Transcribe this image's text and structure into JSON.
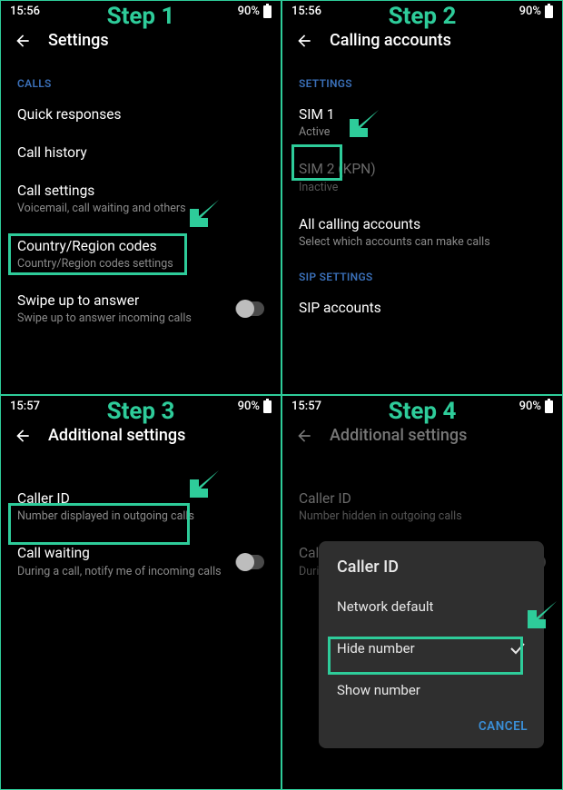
{
  "steps": [
    "Step 1",
    "Step 2",
    "Step 3",
    "Step 4"
  ],
  "status": {
    "time1": "15:56",
    "time2": "15:57",
    "battery": "90%"
  },
  "step1": {
    "title": "Settings",
    "calls_header": "CALLS",
    "quick_responses": "Quick responses",
    "call_history": "Call history",
    "call_settings": "Call settings",
    "call_settings_sub": "Voicemail, call waiting and others",
    "country_codes": "Country/Region codes",
    "country_codes_sub": "Country/Region codes settings",
    "swipe": "Swipe up to answer",
    "swipe_sub": "Swipe up to answer incoming calls"
  },
  "step2": {
    "title": "Calling accounts",
    "settings_header": "SETTINGS",
    "sim1": "SIM 1",
    "sim1_sub": "Active",
    "sim2": "SIM 2  (KPN)",
    "sim2_sub": "Inactive",
    "all_accounts": "All calling accounts",
    "all_accounts_sub": "Select which accounts can make calls",
    "sip_header": "SIP SETTINGS",
    "sip_accounts": "SIP accounts"
  },
  "step3": {
    "title": "Additional settings",
    "caller_id": "Caller ID",
    "caller_id_sub": "Number displayed in outgoing calls",
    "call_waiting": "Call waiting",
    "call_waiting_sub": "During a call, notify me of incoming calls"
  },
  "step4": {
    "title": "Additional settings",
    "caller_id": "Caller ID",
    "caller_id_sub": "Number hidden in outgoing calls",
    "call_waiting_prefix": "Call",
    "call_waiting_sub_prefix": "During",
    "dialog_title": "Caller ID",
    "opt_network": "Network default",
    "opt_hide": "Hide number",
    "opt_show": "Show number",
    "cancel": "CANCEL"
  }
}
